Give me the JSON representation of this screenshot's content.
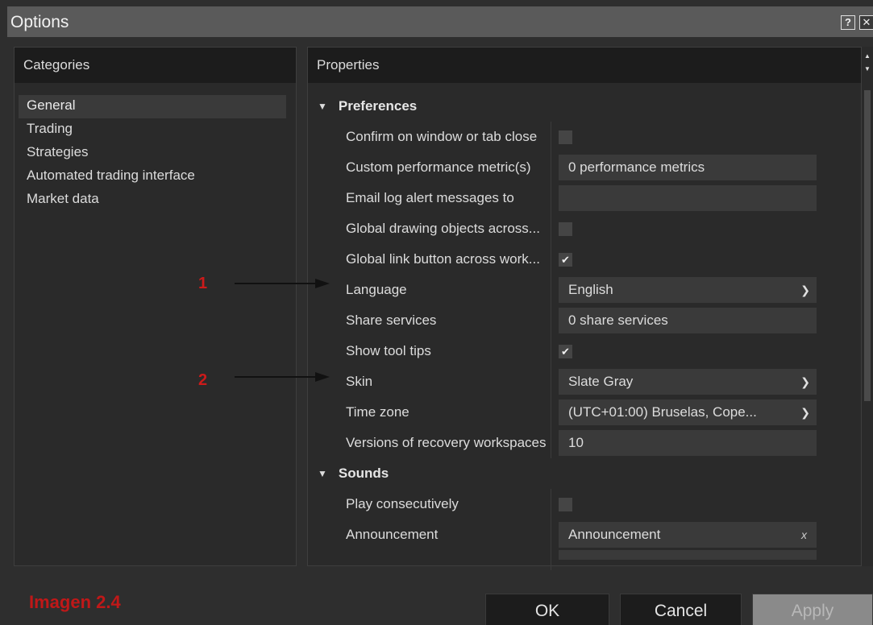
{
  "window": {
    "title": "Options",
    "help_label": "?",
    "close_label": "✕"
  },
  "categories": {
    "header": "Categories",
    "items": [
      {
        "label": "General",
        "selected": true
      },
      {
        "label": "Trading",
        "selected": false
      },
      {
        "label": "Strategies",
        "selected": false
      },
      {
        "label": "Automated trading interface",
        "selected": false
      },
      {
        "label": "Market data",
        "selected": false
      }
    ]
  },
  "properties": {
    "header": "Properties",
    "sections": [
      {
        "title": "Preferences",
        "rows": [
          {
            "label": "Confirm on window or tab close",
            "type": "checkbox",
            "checked": false
          },
          {
            "label": "Custom performance metric(s)",
            "type": "text",
            "value": "0 performance metrics"
          },
          {
            "label": "Email log alert messages to",
            "type": "text",
            "value": ""
          },
          {
            "label": "Global drawing objects across...",
            "type": "checkbox",
            "checked": false
          },
          {
            "label": "Global link button across work...",
            "type": "checkbox",
            "checked": true
          },
          {
            "label": "Language",
            "type": "select",
            "value": "English"
          },
          {
            "label": "Share services",
            "type": "text",
            "value": "0 share services"
          },
          {
            "label": "Show tool tips",
            "type": "checkbox",
            "checked": true
          },
          {
            "label": "Skin",
            "type": "select",
            "value": "Slate Gray"
          },
          {
            "label": "Time zone",
            "type": "select",
            "value": "(UTC+01:00) Bruselas, Cope..."
          },
          {
            "label": "Versions of recovery workspaces",
            "type": "text",
            "value": "10"
          }
        ]
      },
      {
        "title": "Sounds",
        "rows": [
          {
            "label": "Play consecutively",
            "type": "checkbox",
            "checked": false
          },
          {
            "label": "Announcement",
            "type": "file",
            "value": "Announcement",
            "clear_label": "x"
          }
        ]
      }
    ]
  },
  "annotations": {
    "marker_1": "1",
    "marker_2": "2",
    "watermark": "Imagen 2.4"
  },
  "buttons": {
    "ok": "OK",
    "cancel": "Cancel",
    "apply": "Apply"
  },
  "colors": {
    "background": "#2e2e2e",
    "titlebar": "#5a5a5a",
    "header": "#1c1c1c",
    "input": "#3a3a3a",
    "annotation_red": "#cc1a1a"
  }
}
